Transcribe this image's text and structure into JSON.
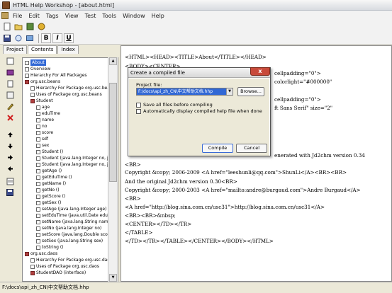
{
  "window": {
    "title": "HTML Help Workshop - [about.html]"
  },
  "menu": [
    "File",
    "Edit",
    "Tags",
    "View",
    "Test",
    "Tools",
    "Window",
    "Help"
  ],
  "toolbar2": {
    "bold": "B",
    "italic": "I",
    "underline": "U"
  },
  "tabs": [
    "Project",
    "Contents",
    "Index"
  ],
  "tree": [
    "About",
    "Overview",
    "Hierarchy For All Packages",
    "org.usc.beans",
    "Hierarchy For Package org.usc.beans",
    "Uses of Package org.usc.beans",
    "Student",
    "age",
    "eduTime",
    "name",
    "no",
    "score",
    "sdf",
    "sex",
    "Student ()",
    "Student (java.lang.Integer no, jav",
    "Student (java.lang.Integer no, jav",
    "getAge ()",
    "getEduTime ()",
    "getName ()",
    "getNo ()",
    "getScore ()",
    "getSex ()",
    "setAge (java.lang.Integer age)",
    "setEduTime (java.util.Date eduTir",
    "setName (java.lang.String name)",
    "setNo (java.lang.Integer no)",
    "setScore (java.lang.Double score",
    "setSex (java.lang.String sex)",
    "toString ()",
    "org.usc.daos",
    "Hierarchy For Package org.usc.daos",
    "Uses of Package org.usc.daos",
    "StudentDAO (interface)"
  ],
  "editor": {
    "lines": [
      "<HTML><HEAD><TITLE>About</TITLE></HEAD>",
      "<BODY><CENTER>",
      "cellpadding=\"0\">",
      "colorlight=\"#000000\"",
      "cellpadding=\"0\">",
      "ft Sans Serif\" size=\"2\"",
      "enerated with Jd2chm version 0.34",
      "<BR>",
      "Copyright &copy; 2006-2009 <A href=\"leeshunli@qq.com\">ShunLi</A><BR><BR>",
      "And the original Jd2chm version 0.30<BR>",
      "Copyright &copy; 2000-2003 <A href=\"mailto:andre@burgaud.com\">Andre Burgaud</A>",
      "<BR>",
      "<A href=\"http://blog.sina.com.cn/usc31\">http://blog.sina.com.cn/usc31</A>",
      "<BR><BR>&nbsp;",
      "<CENTER></TD></TR>",
      "</TABLE>",
      "</TD></TR></TABLE></CENTER></BODY></HTML>"
    ]
  },
  "dialog": {
    "title": "Create a compiled file",
    "project_label": "Project file:",
    "project_value": "F:\\docs\\api_zh_CN\\中文帮助文档.hhp",
    "browse": "Browse...",
    "check1": "Save all files before compiling",
    "check2": "Automatically display compiled help file when done",
    "compile": "Compile",
    "cancel": "Cancel",
    "close": "x"
  },
  "status": "F:\\docs\\api_zh_CN\\中文帮助文档.hhp"
}
